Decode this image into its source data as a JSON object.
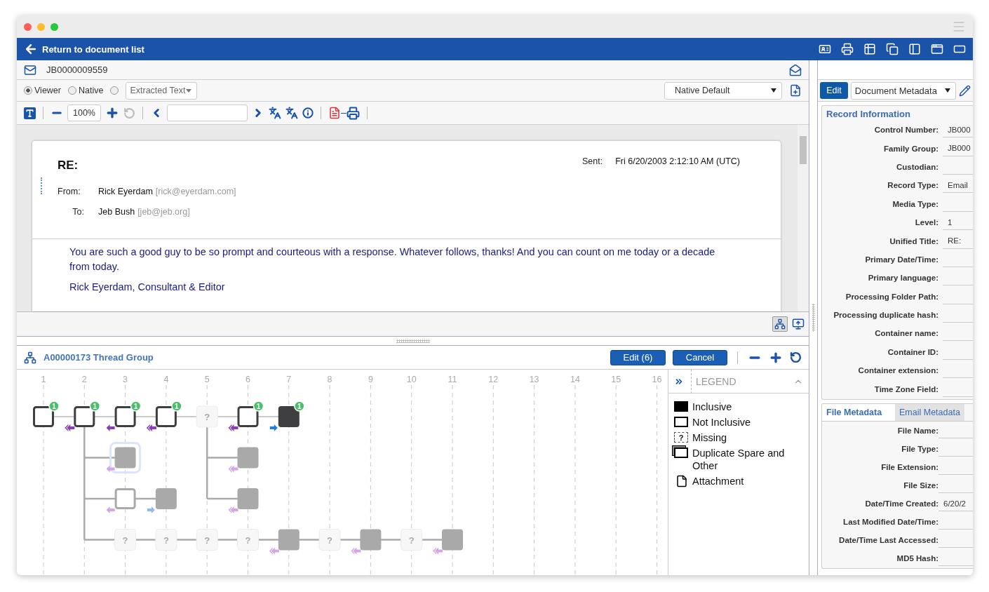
{
  "window": {
    "back_link": "Return to document list"
  },
  "document": {
    "id": "JB0000009559"
  },
  "view_options": [
    {
      "label": "Viewer",
      "selected": true
    },
    {
      "label": "Native",
      "selected": false
    },
    {
      "selected": false,
      "dropdown": "Extracted Text"
    }
  ],
  "native_select": "Native Default",
  "toolbar": {
    "zoom": "100%"
  },
  "email": {
    "subject": "RE:",
    "sent_label": "Sent:",
    "sent": "Fri 6/20/2003 2:12:10 AM (UTC)",
    "from_label": "From:",
    "from_name": "Rick Eyerdam",
    "from_address": "[rick@eyerdam.com]",
    "to_label": "To:",
    "to_name": "Jeb Bush",
    "to_address": "[jeb@jeb.org]",
    "body": [
      "You are such a good guy to be so prompt and courteous with a response. Whatever follows, thanks! And you can count on me today or a decade from today.",
      "Rick Eyerdam, Consultant & Editor"
    ]
  },
  "thread": {
    "title": "A00000173 Thread Group",
    "buttons": [
      "Edit (6)",
      "Cancel"
    ],
    "columns": [
      "1",
      "2",
      "3",
      "4",
      "5",
      "6",
      "7",
      "8",
      "9",
      "10",
      "11",
      "12",
      "13",
      "14",
      "15",
      "16"
    ],
    "rows": [
      {
        "cells": [
          {
            "kind": "not-inclusive",
            "dimmed": false,
            "selected": false,
            "badge": "1"
          },
          {
            "kind": "not-inclusive",
            "dimmed": false,
            "selected": false,
            "badge": "1",
            "arrow": {
              "kind": "reply-all"
            }
          },
          {
            "kind": "not-inclusive",
            "dimmed": false,
            "selected": false,
            "badge": "1",
            "arrow": {
              "kind": "reply"
            }
          },
          {
            "kind": "not-inclusive",
            "dimmed": false,
            "selected": false,
            "badge": "1",
            "arrow": {
              "kind": "reply-all"
            }
          },
          {
            "kind": "missing",
            "label": "?"
          },
          {
            "kind": "not-inclusive",
            "dimmed": false,
            "selected": false,
            "badge": "1",
            "arrow": {
              "kind": "reply-all"
            }
          },
          {
            "kind": "inclusive",
            "dimmed": false,
            "selected": false,
            "badge": "1",
            "arrow": {
              "kind": "forward"
            }
          }
        ]
      },
      {
        "cells": [
          null,
          null,
          {
            "kind": "inclusive",
            "dimmed": true,
            "selected": true,
            "arrow": {
              "kind": "reply"
            }
          },
          null,
          null,
          {
            "kind": "inclusive",
            "dimmed": true,
            "selected": false,
            "arrow": {
              "kind": "reply-all"
            }
          }
        ]
      },
      {
        "cells": [
          null,
          null,
          {
            "kind": "not-inclusive",
            "dimmed": true,
            "selected": false,
            "arrow": {
              "kind": "reply"
            }
          },
          {
            "kind": "inclusive",
            "dimmed": true,
            "selected": false,
            "arrow": {
              "kind": "forward"
            }
          },
          null,
          {
            "kind": "inclusive",
            "dimmed": true,
            "selected": false,
            "arrow": {
              "kind": "reply-all"
            }
          }
        ]
      },
      {
        "cells": [
          null,
          null,
          {
            "kind": "missing",
            "label": "?"
          },
          {
            "kind": "missing",
            "label": "?"
          },
          {
            "kind": "missing",
            "label": "?"
          },
          {
            "kind": "missing",
            "label": "?"
          },
          {
            "kind": "inclusive",
            "dimmed": true,
            "selected": false,
            "arrow": {
              "kind": "reply-all"
            }
          },
          {
            "kind": "missing",
            "label": "?"
          },
          {
            "kind": "inclusive",
            "dimmed": true,
            "selected": false,
            "arrow": {
              "kind": "reply-all"
            }
          },
          {
            "kind": "missing",
            "label": "?"
          },
          {
            "kind": "inclusive",
            "dimmed": true,
            "selected": false,
            "arrow": {
              "kind": "reply-all"
            }
          }
        ]
      }
    ]
  },
  "legend": {
    "title": "LEGEND",
    "items": [
      {
        "kind": "inclusive",
        "label": "Inclusive"
      },
      {
        "kind": "not-inclusive",
        "label": "Not Inclusive"
      },
      {
        "kind": "missing",
        "label": "Missing",
        "glyph": "?"
      },
      {
        "kind": "duplicate",
        "label": "Duplicate Spare and Other"
      },
      {
        "kind": "attachment",
        "label": "Attachment"
      }
    ]
  },
  "metadata": {
    "edit_button": "Edit",
    "view_select": "Document Metadata",
    "record": {
      "title": "Record Information",
      "fields": [
        {
          "label": "Control Number:",
          "value": "JB000"
        },
        {
          "label": "Family Group:",
          "value": "JB000"
        },
        {
          "label": "Custodian:"
        },
        {
          "label": "Record Type:",
          "value": "Email"
        },
        {
          "label": "Media Type:"
        },
        {
          "label": "Level:",
          "value": "1"
        },
        {
          "label": "Unified Title:",
          "value": "RE:"
        },
        {
          "label": "Primary Date/Time:"
        },
        {
          "label": "Primary language:"
        },
        {
          "label": "Processing Folder Path:"
        },
        {
          "label": "Processing duplicate hash:"
        },
        {
          "label": "Container name:"
        },
        {
          "label": "Container ID:"
        },
        {
          "label": "Container extension:"
        },
        {
          "label": "Time Zone Field:"
        }
      ]
    },
    "tabs": [
      {
        "label": "File Metadata",
        "selected": true
      },
      {
        "label": "Email Metadata",
        "selected": false
      }
    ],
    "file_fields": [
      {
        "label": "File Name:"
      },
      {
        "label": "File Type:"
      },
      {
        "label": "File Extension:"
      },
      {
        "label": "File Size:"
      },
      {
        "label": "Date/Time Created:",
        "value": "6/20/2"
      },
      {
        "label": "Last Modified Date/Time:"
      },
      {
        "label": "Date/Time Last Accessed:"
      },
      {
        "label": "MD5 Hash:"
      }
    ]
  }
}
